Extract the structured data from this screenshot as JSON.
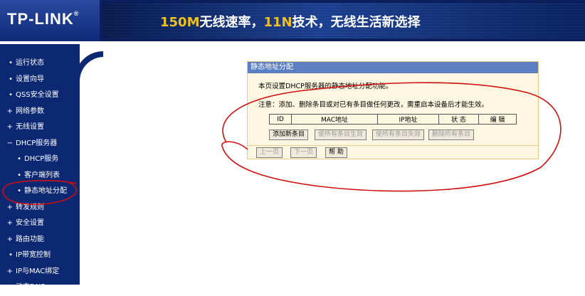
{
  "header": {
    "logo": "TP-LINK",
    "logo_mark": "®",
    "banner_part1": "150M",
    "banner_part2": "无线速率，",
    "banner_part3": "11N",
    "banner_part4": "技术，无线生活新选择"
  },
  "sidebar": {
    "items": [
      {
        "label": "运行状态",
        "bullet": "•"
      },
      {
        "label": "设置向导",
        "bullet": "•"
      },
      {
        "label": "QSS安全设置",
        "bullet": "•"
      },
      {
        "label": "网络参数",
        "bullet": "+"
      },
      {
        "label": "无线设置",
        "bullet": "+"
      },
      {
        "label": "DHCP服务器",
        "bullet": "−"
      },
      {
        "label": "DHCP服务",
        "bullet": "•"
      },
      {
        "label": "客户端列表",
        "bullet": "•"
      },
      {
        "label": "静态地址分配",
        "bullet": "•"
      },
      {
        "label": "转发规则",
        "bullet": "+"
      },
      {
        "label": "安全设置",
        "bullet": "+"
      },
      {
        "label": "路由功能",
        "bullet": "+"
      },
      {
        "label": "IP带宽控制",
        "bullet": "•"
      },
      {
        "label": "IP与MAC绑定",
        "bullet": "+"
      },
      {
        "label": "动态DNS",
        "bullet": "•"
      }
    ]
  },
  "panel": {
    "title": "静态地址分配",
    "description": "本页设置DHCP服务器的静态地址分配功能。",
    "note": "注意：添加、删除条目或对已有条目做任何更改，需重启本设备后才能生效。",
    "columns": [
      "ID",
      "MAC地址",
      "IP地址",
      "状 态",
      "编 辑"
    ],
    "buttons": {
      "add": "添加新条目",
      "enable_all": "使所有条目生效",
      "disable_all": "使所有条目失效",
      "delete_all": "删除所有条目",
      "prev": "上一页",
      "next": "下一页",
      "help": "帮 助"
    }
  },
  "colors": {
    "header_bg": "#0b1f5c",
    "sidebar_bg": "#0c2873",
    "panel_bg": "#fdf6e0",
    "panel_title_bg": "#5c7fc4",
    "highlight_text": "#f0c020",
    "annotation_red": "#d01010"
  }
}
